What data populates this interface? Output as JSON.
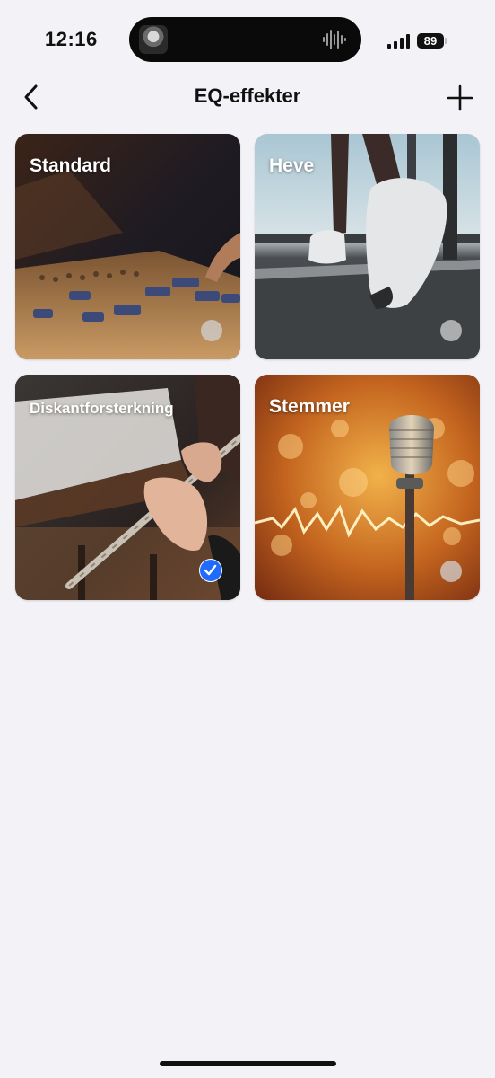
{
  "status_bar": {
    "time": "12:16",
    "battery": "89"
  },
  "nav": {
    "title": "EQ-effekter",
    "back_icon": "chevron-left-icon",
    "add_icon": "plus-icon"
  },
  "presets": [
    {
      "label": "Standard",
      "selected": false
    },
    {
      "label": "Heve",
      "selected": false
    },
    {
      "label": "Diskantforsterkning",
      "selected": true
    },
    {
      "label": "Stemmer",
      "selected": false
    }
  ],
  "colors": {
    "accent": "#1f6bff",
    "background": "#f2f2f7"
  }
}
